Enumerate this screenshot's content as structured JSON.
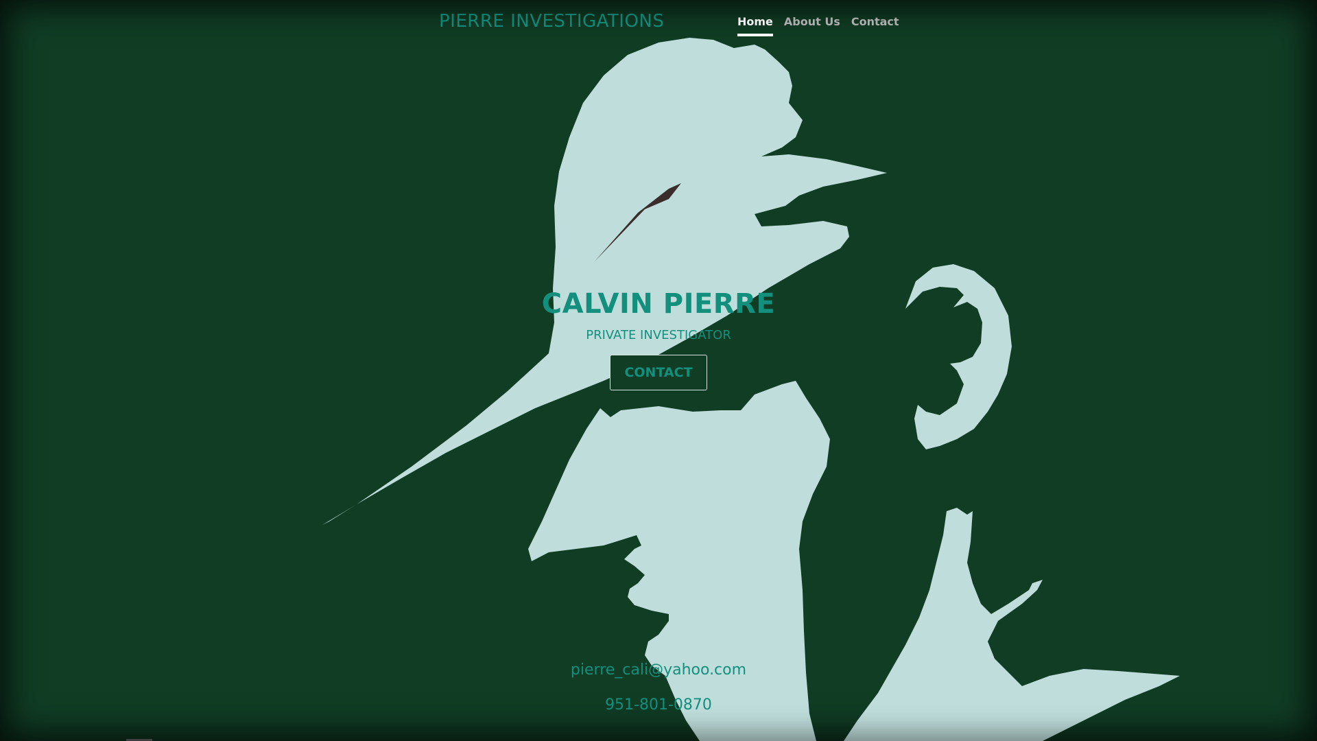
{
  "header": {
    "brand": "PIERRE INVESTIGATIONS",
    "nav": [
      {
        "label": "Home",
        "active": true
      },
      {
        "label": "About Us",
        "active": false
      },
      {
        "label": "Contact",
        "active": false
      }
    ]
  },
  "hero": {
    "title": "CALVIN PIERRE",
    "subtitle": "PRIVATE INVESTIGATOR",
    "button_label": "CONTACT"
  },
  "footer": {
    "email": "pierre_cali@yahoo.com",
    "phone": "951-801-0870"
  },
  "colors": {
    "background": "#113d25",
    "silhouette": "#bfdedb",
    "accent_text": "#138f7e",
    "nav_active": "#ffffff",
    "nav_inactive": "#b8b8b8"
  },
  "icons": [
    "detective-silhouette-illustration"
  ]
}
